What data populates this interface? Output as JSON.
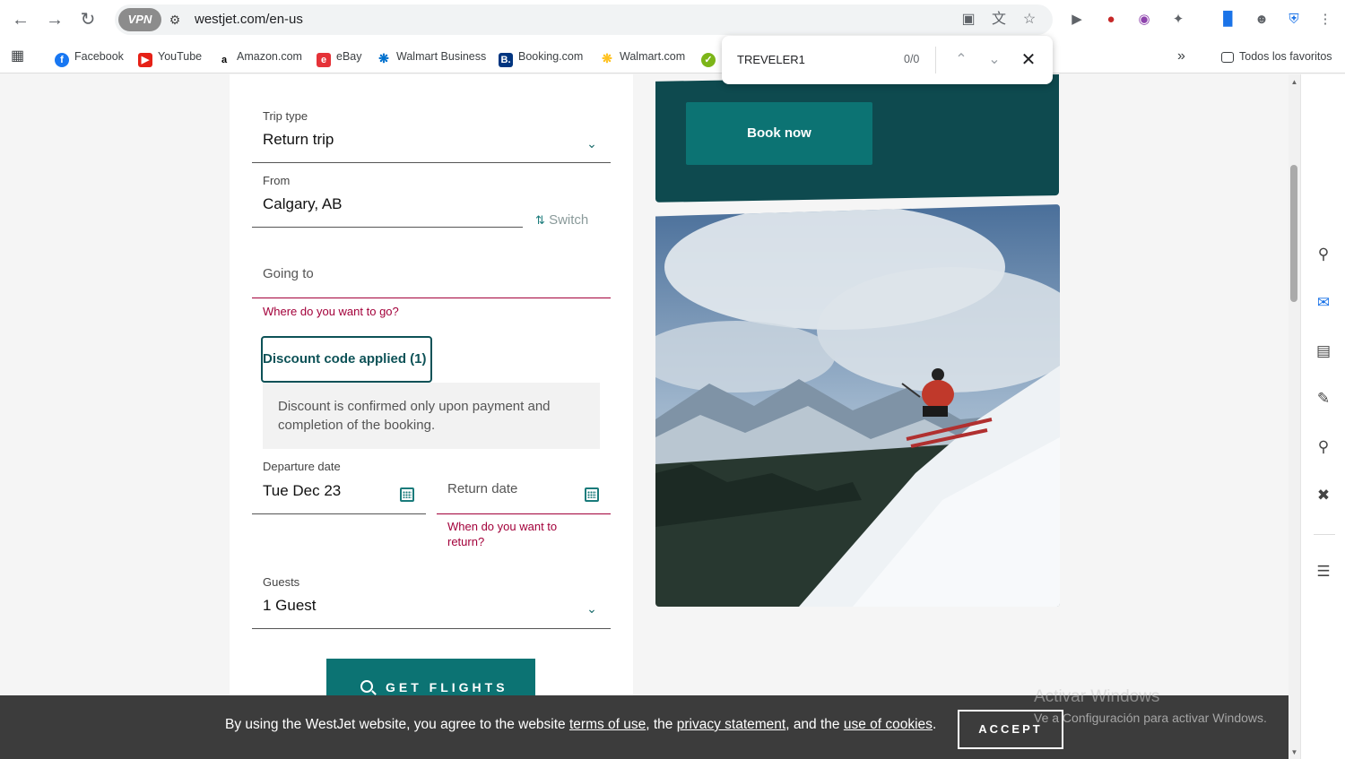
{
  "browser": {
    "url": "westjet.com/en-us",
    "vpn_label": "VPN",
    "bookmarks": [
      {
        "label": "Facebook"
      },
      {
        "label": "YouTube"
      },
      {
        "label": "Amazon.com"
      },
      {
        "label": "eBay"
      },
      {
        "label": "Walmart Business"
      },
      {
        "label": "Booking.com"
      },
      {
        "label": "Walmart.com"
      }
    ],
    "more_bookmarks": "»",
    "all_bookmarks": "Todos los favoritos",
    "find": {
      "query": "TREVELER1",
      "count": "0/0"
    }
  },
  "form": {
    "trip_type": {
      "label": "Trip type",
      "value": "Return trip"
    },
    "from": {
      "label": "From",
      "value": "Calgary, AB"
    },
    "switch_label": "Switch",
    "going_to": {
      "placeholder": "Going to",
      "error": "Where do you want to go?"
    },
    "discount": {
      "button": "Discount code applied (1)",
      "info": "Discount is confirmed only upon payment and completion of the booking."
    },
    "departure": {
      "label": "Departure date",
      "value": "Tue Dec 23"
    },
    "return": {
      "placeholder": "Return date",
      "error": "When do you want to return?"
    },
    "guests": {
      "label": "Guests",
      "value": "1 Guest"
    },
    "submit": "GET FLIGHTS"
  },
  "promo": {
    "button": "Book now"
  },
  "cookie": {
    "text_1": "By using the WestJet website, you agree to the website ",
    "link_terms": "terms of use",
    "text_2": ", the ",
    "link_privacy": "privacy statement",
    "text_3": ", and the ",
    "link_cookies": "use of cookies",
    "text_4": ".",
    "accept": "ACCEPT"
  },
  "watermark": {
    "title": "Activar Windows",
    "subtitle": "Ve a Configuración para activar Windows."
  }
}
